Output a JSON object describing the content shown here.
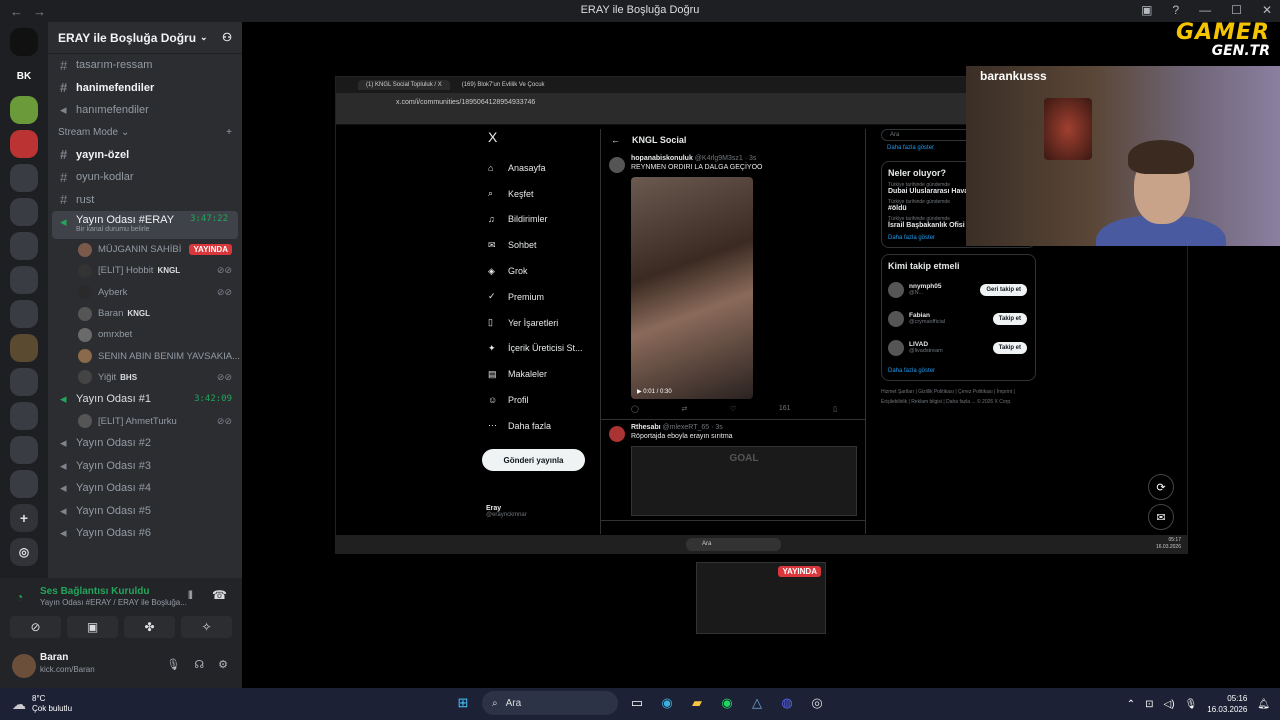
{
  "window": {
    "title": "ERAY ile Boşluğa Doğru",
    "back": "←",
    "forward": "→"
  },
  "servers": [
    "BK"
  ],
  "guild": {
    "name": "ERAY ile Boşluğa Doğru"
  },
  "channels_top": [
    {
      "name": "tasarım-ressam",
      "bold": false
    },
    {
      "name": "hanimefendiler",
      "bold": true
    },
    {
      "name": "hanımefendiler",
      "bold": false
    }
  ],
  "stream_mode": "Stream Mode",
  "channels_mid": [
    {
      "name": "yayın-özel",
      "bold": true
    },
    {
      "name": "oyun-kodlar",
      "bold": false
    },
    {
      "name": "rust",
      "bold": false
    }
  ],
  "voice1": {
    "name": "Yayın Odası #ERAY",
    "status": "Bir kanal durumu belirle",
    "time": "3:47:22"
  },
  "voice1_users": [
    {
      "name": "MÜJGANIN SAHİBİ",
      "live": "YAYINDA",
      "tag": ""
    },
    {
      "name": "[ELIT] Hobbit",
      "live": "",
      "tag": "KNGL"
    },
    {
      "name": "Ayberk",
      "live": "",
      "tag": ""
    },
    {
      "name": "Baran",
      "live": "",
      "tag": "KNGL"
    },
    {
      "name": "omrxbet",
      "live": "",
      "tag": ""
    },
    {
      "name": "SENIN ABIN BENIM YAVSAKIA...",
      "live": "",
      "tag": ""
    },
    {
      "name": "Yiğit",
      "live": "",
      "tag": "BHS"
    }
  ],
  "voice2": {
    "name": "Yayın Odası #1",
    "time": "3:42:09"
  },
  "voice2_users": [
    {
      "name": "[ELIT] AhmetTurku"
    }
  ],
  "voice_others": [
    "Yayın Odası #2",
    "Yayın Odası #3",
    "Yayın Odası #4",
    "Yayın Odası #5",
    "Yayın Odası #6"
  ],
  "voice_panel": {
    "status": "Ses Bağlantısı Kuruldu",
    "sub": "Yayın Odası #ERAY / ERAY ile Boşluğa...",
    "user": "Baran",
    "user_status": "kick.com/Baran"
  },
  "logo": {
    "line1": "GAMER",
    "line2": "GEN.TR"
  },
  "cam": {
    "name": "barankusss"
  },
  "browser": {
    "tab1": "(1) KNGL Social Topluluk / X",
    "tab2": "(169) Blok7'un Evlilik Ve Çocuk",
    "url": "x.com/i/communities/1895064128954933746"
  },
  "xnav": [
    {
      "icon": "⌂",
      "label": "Anasayfa"
    },
    {
      "icon": "⌕",
      "label": "Keşfet"
    },
    {
      "icon": "♫",
      "label": "Bildirimler"
    },
    {
      "icon": "✉",
      "label": "Sohbet"
    },
    {
      "icon": "◈",
      "label": "Grok"
    },
    {
      "icon": "✓",
      "label": "Premium"
    },
    {
      "icon": "▯",
      "label": "Yer İşaretleri"
    },
    {
      "icon": "✦",
      "label": "İçerik Üreticisi St..."
    },
    {
      "icon": "▤",
      "label": "Makaleler"
    },
    {
      "icon": "☺",
      "label": "Profil"
    },
    {
      "icon": "⋯",
      "label": "Daha fazla"
    }
  ],
  "x_logo": "X",
  "post_button": "Gönderi yayınla",
  "xprofile": {
    "name": "Eray",
    "handle": "@eraynckmnar"
  },
  "feed": {
    "title": "KNGL Social",
    "post1": {
      "user": "hopanabiskonuluk",
      "handle": "@K4rlg9M3sz1 · 3s",
      "text": "REYNMEN ORDIRI LA DALGA GEÇİYOO",
      "time": "0:01 / 0:30",
      "views": "161"
    },
    "post2": {
      "user": "Rthesabı",
      "handle": "@mlexeRT_65 · 3s",
      "text": "Röportajda eboyla erayın sırıtma",
      "img_text": "GOAL"
    }
  },
  "right": {
    "search": "Ara",
    "more": "Daha fazla göster",
    "trends_title": "Neler oluyor?",
    "trends": [
      {
        "small": "Türkiye tarihinde gündemde",
        "title": "Dubai Uluslararası Haval"
      },
      {
        "small": "Türkiye tarihinde gündemde",
        "title": "#öldü"
      },
      {
        "small": "Türkiye tarihinde gündemde",
        "title": "İsrail Başbakanlık Ofisi"
      }
    ],
    "follow_title": "Kimi takip etmeli",
    "follows": [
      {
        "name": "nnymph05",
        "handle": "@N...",
        "btn": "Geri takip et"
      },
      {
        "name": "Fabian",
        "handle": "@crymaofficial",
        "btn": "Takip et"
      },
      {
        "name": "LIVAD",
        "handle": "@livadstream",
        "btn": "Takip et"
      }
    ],
    "footer": "Hizmet Şartları | Gizlilik Politikası | Çerez Politikası | İmprint | Erişilebilirlik | Reklam bilgisi | Daha fazla ... © 2026 X Corp."
  },
  "btask": {
    "search": "Ara",
    "time": "05:17",
    "date": "16.03.2026"
  },
  "thumb": {
    "live": "YAYINDA"
  },
  "taskbar": {
    "temp": "8°C",
    "weather": "Çok bulutlu",
    "search": "Ara",
    "time": "05:16",
    "date": "16.03.2026"
  }
}
